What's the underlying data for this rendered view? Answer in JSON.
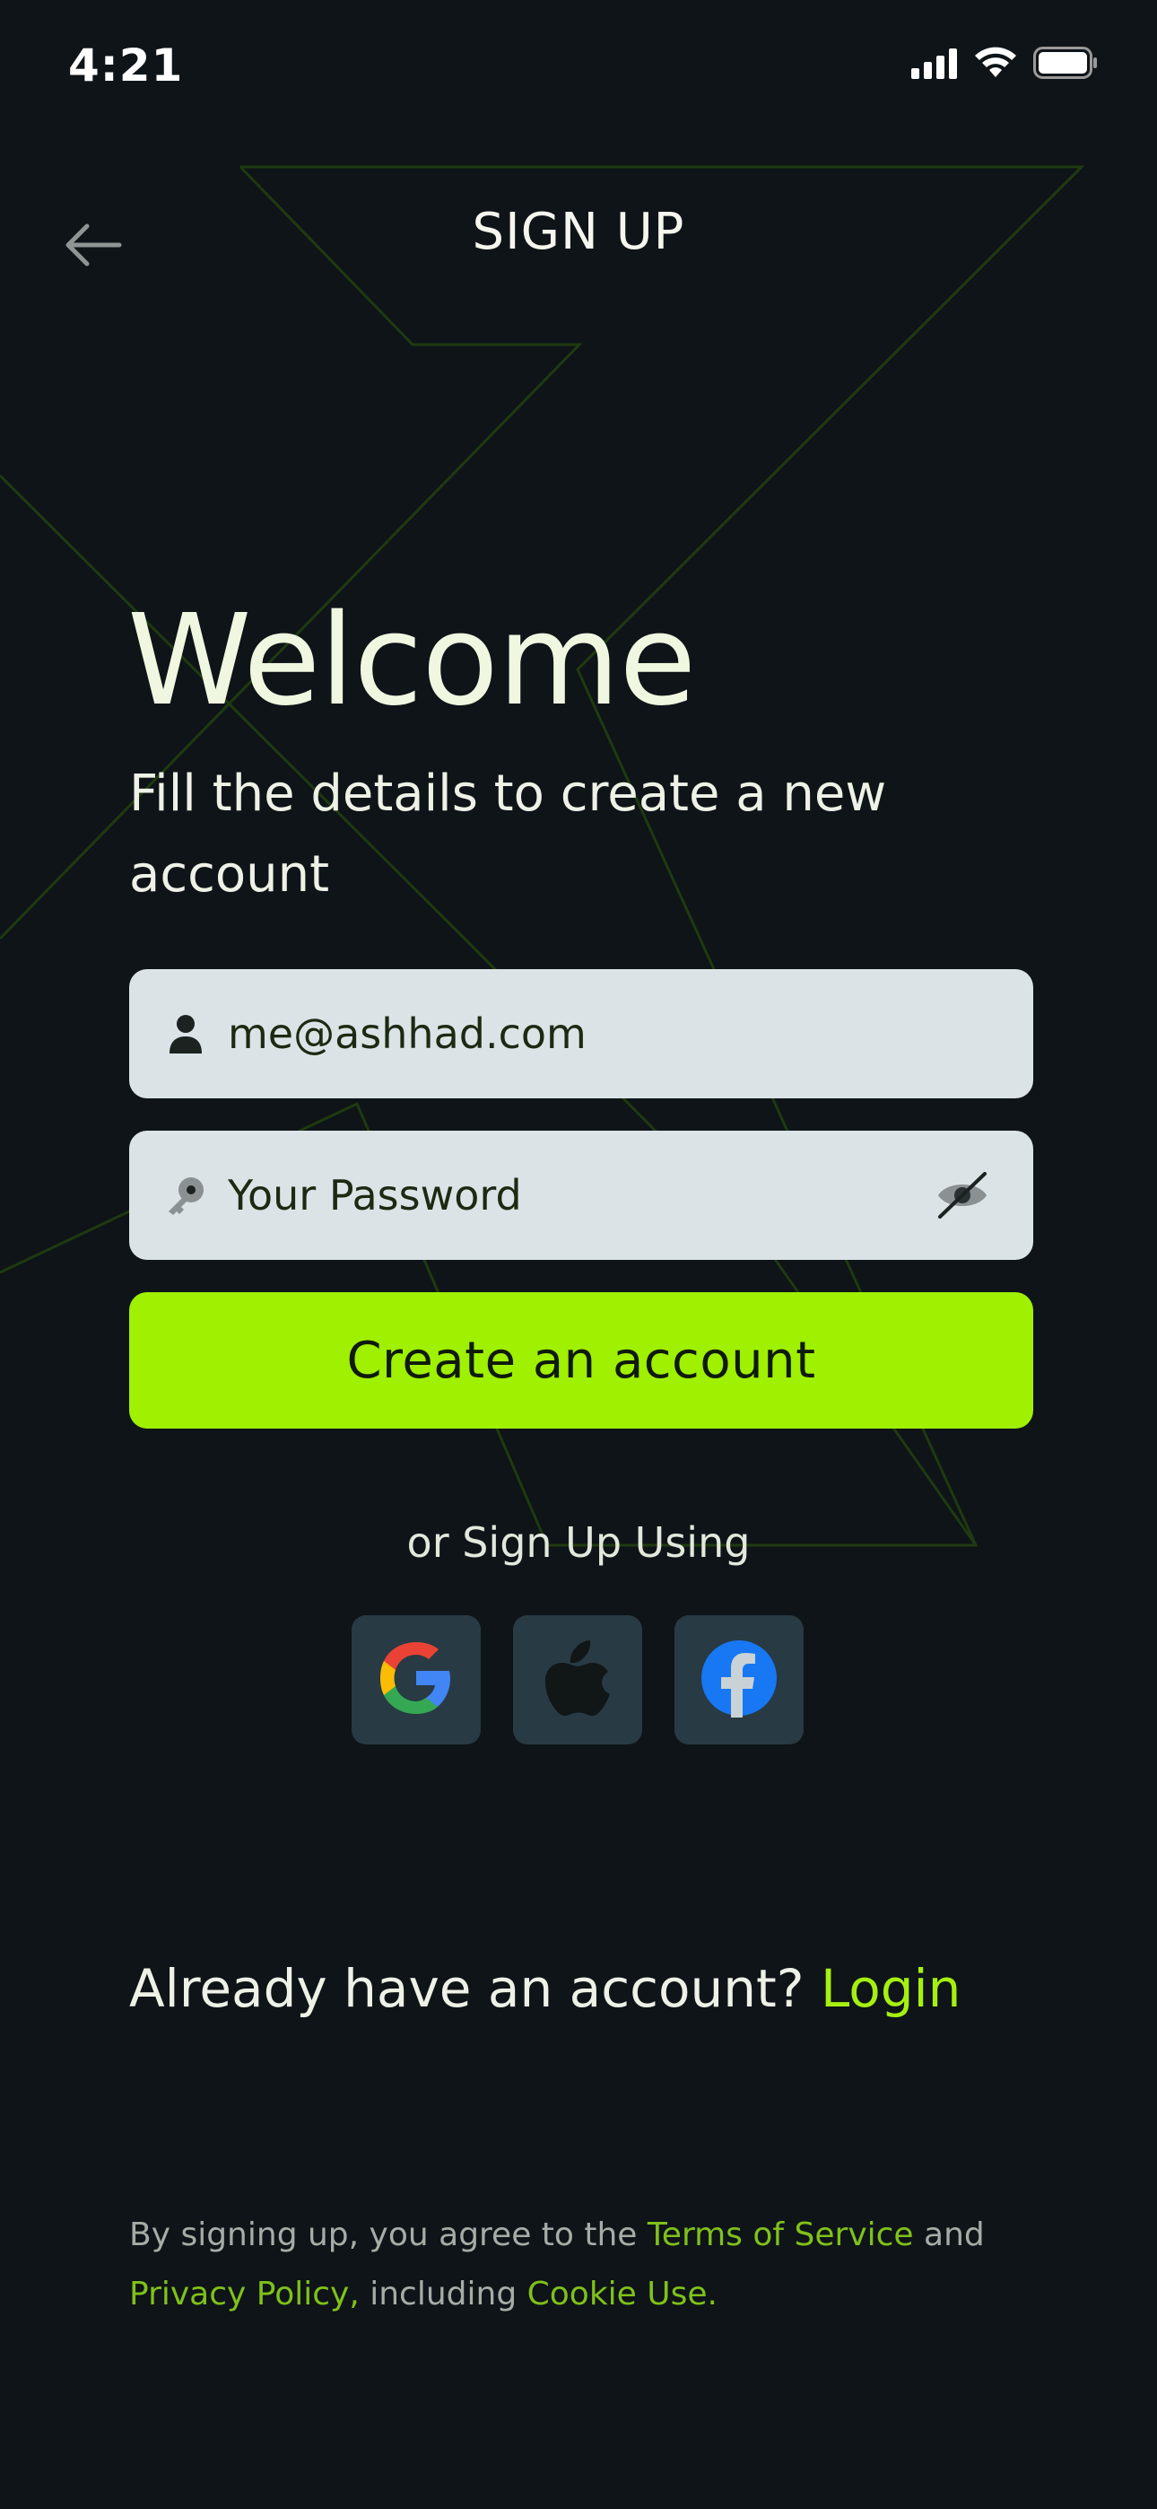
{
  "status_bar": {
    "time": "4:21",
    "signal_icon": "cellular-signal-icon",
    "wifi_icon": "wifi-icon",
    "battery_icon": "battery-icon"
  },
  "header": {
    "back_icon": "arrow-left-icon",
    "title": "SIGN UP"
  },
  "welcome": {
    "heading": "Welcome",
    "subheading": "Fill the details to create a new account"
  },
  "form": {
    "email": {
      "icon": "user-icon",
      "value": "me@ashhad.com",
      "placeholder": ""
    },
    "password": {
      "icon": "key-icon",
      "value": "",
      "placeholder": "Your Password",
      "toggle_icon": "eye-off-icon"
    },
    "submit_label": "Create an account"
  },
  "social": {
    "divider_text": "or Sign Up Using",
    "providers": [
      {
        "name": "google",
        "icon": "google-icon"
      },
      {
        "name": "apple",
        "icon": "apple-icon"
      },
      {
        "name": "facebook",
        "icon": "facebook-icon"
      }
    ]
  },
  "login_prompt": {
    "text": "Already have an account?",
    "link": "Login"
  },
  "terms": {
    "prefix": "By signing up, you agree to the",
    "terms_link": "Terms of Service",
    "and": "and",
    "privacy_link": "Privacy Policy,",
    "including": "including",
    "cookie_link": "Cookie Use."
  },
  "colors": {
    "background": "#0e1418",
    "accent": "#a0f002",
    "field_bg": "#dce3e6",
    "social_bg": "#283a43",
    "link_muted": "#80c11a"
  }
}
